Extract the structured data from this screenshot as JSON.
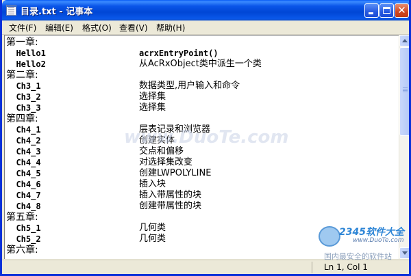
{
  "window": {
    "title": "目录.txt - 记事本"
  },
  "menu": [
    {
      "label": "文件(F)"
    },
    {
      "label": "编辑(E)"
    },
    {
      "label": "格式(O)"
    },
    {
      "label": "查看(V)"
    },
    {
      "label": "帮助(H)"
    }
  ],
  "lines": [
    {
      "c1": "第一章:",
      "c2": "",
      "heading": true
    },
    {
      "c1": "  Hello1",
      "c2": "acrxEntryPoint()",
      "bold2": true
    },
    {
      "c1": "  Hello2",
      "c2": "从AcRxObject类中派生一个类"
    },
    {
      "c1": "第二章:",
      "c2": "",
      "heading": true
    },
    {
      "c1": "  Ch3_1",
      "c2": "数据类型,用户输入和命令"
    },
    {
      "c1": "  Ch3_2",
      "c2": "选择集"
    },
    {
      "c1": "  Ch3_3",
      "c2": "选择集"
    },
    {
      "c1": "第四章:",
      "c2": "",
      "heading": true
    },
    {
      "c1": "  Ch4_1",
      "c2": "层表记录和浏览器"
    },
    {
      "c1": "  Ch4_2",
      "c2": "创建实体"
    },
    {
      "c1": "  Ch4_3",
      "c2": "交点和偏移"
    },
    {
      "c1": "  Ch4_4",
      "c2": "对选择集改变"
    },
    {
      "c1": "  Ch4_5",
      "c2": "创建LWPOLYLINE"
    },
    {
      "c1": "  Ch4_6",
      "c2": "插入块"
    },
    {
      "c1": "  Ch4_7",
      "c2": "插入带属性的块"
    },
    {
      "c1": "  Ch4_8",
      "c2": "创建带属性的块"
    },
    {
      "c1": "第五章:",
      "c2": "",
      "heading": true
    },
    {
      "c1": "  Ch5_1",
      "c2": "几何类"
    },
    {
      "c1": "  Ch5_2",
      "c2": "几何类"
    },
    {
      "c1": "第六章:",
      "c2": "",
      "heading": true
    }
  ],
  "status": {
    "position": "Ln 1, Col 1"
  },
  "watermark": {
    "text": "www.DuoTe.com"
  },
  "logo": {
    "mark": "2345软件大全",
    "url": "www.DuoTe.com",
    "slogan": "国内最安全的软件站"
  },
  "colors": {
    "titlebar": "#0054e3",
    "close_button": "#d0461f",
    "window_bg": "#ece9d8"
  },
  "icons": {
    "app": "notepad-icon",
    "minimize": "minimize-icon",
    "maximize": "maximize-icon",
    "close": "close-icon"
  }
}
